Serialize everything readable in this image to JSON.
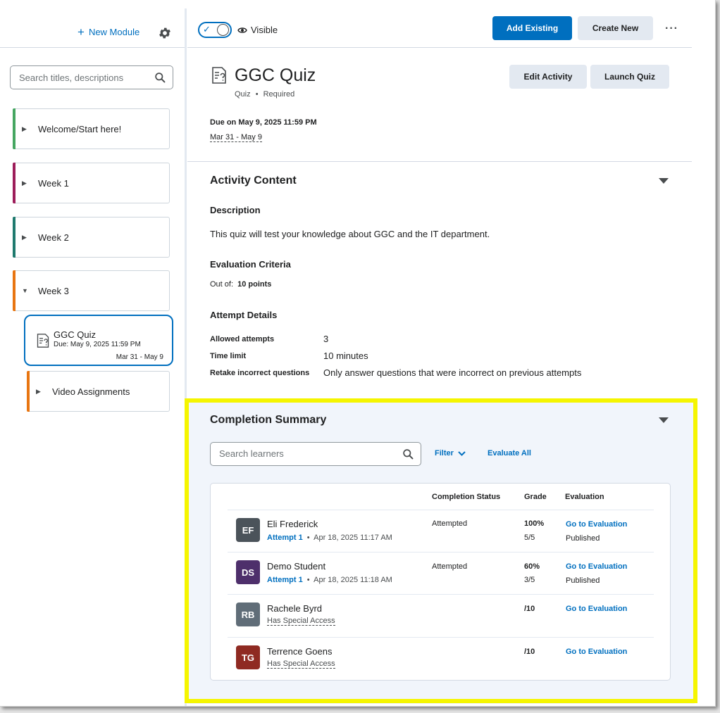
{
  "sidebar": {
    "new_module": "New Module",
    "search_placeholder": "Search titles, descriptions",
    "modules": [
      {
        "label": "Welcome/Start here!",
        "color": "#46a661"
      },
      {
        "label": "Week 1",
        "color": "#9d1d5a"
      },
      {
        "label": "Week 2",
        "color": "#1f7a6e"
      },
      {
        "label": "Week 3",
        "color": "#e87511"
      }
    ],
    "active_item": {
      "title": "GGC Quiz",
      "due": "Due: May 9, 2025 11:59 PM",
      "range": "Mar 31 - May 9"
    },
    "sub_module": {
      "label": "Video Assignments",
      "color": "#e87511"
    }
  },
  "toolbar": {
    "visible_label": "Visible",
    "add_existing": "Add Existing",
    "create_new": "Create New",
    "more": "···"
  },
  "activity": {
    "title": "GGC Quiz",
    "type": "Quiz",
    "required": "Required",
    "edit_button": "Edit Activity",
    "launch_button": "Launch Quiz",
    "due": "Due on May 9, 2025 11:59 PM",
    "range": "Mar 31 - May 9"
  },
  "content": {
    "heading": "Activity Content",
    "description_heading": "Description",
    "description": "This quiz will test your knowledge about GGC and the IT department.",
    "criteria_heading": "Evaluation Criteria",
    "out_of_label": "Out of:",
    "out_of_value": "10 points",
    "attempt_heading": "Attempt Details",
    "details": [
      {
        "label": "Allowed attempts",
        "value": "3"
      },
      {
        "label": "Time limit",
        "value": "10 minutes"
      },
      {
        "label": "Retake incorrect questions",
        "value": "Only answer questions that were incorrect on previous attempts"
      }
    ]
  },
  "completion": {
    "heading": "Completion Summary",
    "search_placeholder": "Search learners",
    "filter": "Filter",
    "evaluate_all": "Evaluate All",
    "columns": {
      "status": "Completion Status",
      "grade": "Grade",
      "evaluation": "Evaluation"
    },
    "learners": [
      {
        "initials": "EF",
        "color": "#4b535a",
        "name": "Eli Frederick",
        "attempt": "Attempt 1",
        "date": "Apr 18, 2025 11:17 AM",
        "access": "",
        "status": "Attempted",
        "grade_pct": "100%",
        "grade_pts": "5/5",
        "eval_link": "Go to Evaluation",
        "eval_status": "Published"
      },
      {
        "initials": "DS",
        "color": "#4e2f6b",
        "name": "Demo Student",
        "attempt": "Attempt 1",
        "date": "Apr 18, 2025 11:18 AM",
        "access": "",
        "status": "Attempted",
        "grade_pct": "60%",
        "grade_pts": "3/5",
        "eval_link": "Go to Evaluation",
        "eval_status": "Published"
      },
      {
        "initials": "RB",
        "color": "#606d78",
        "name": "Rachele Byrd",
        "attempt": "",
        "date": "",
        "access": "Has Special Access",
        "status": "",
        "grade_pct": "/10",
        "grade_pts": "",
        "eval_link": "Go to Evaluation",
        "eval_status": ""
      },
      {
        "initials": "TG",
        "color": "#8f2a22",
        "name": "Terrence Goens",
        "attempt": "",
        "date": "",
        "access": "Has Special Access",
        "status": "",
        "grade_pct": "/10",
        "grade_pts": "",
        "eval_link": "Go to Evaluation",
        "eval_status": ""
      }
    ]
  }
}
